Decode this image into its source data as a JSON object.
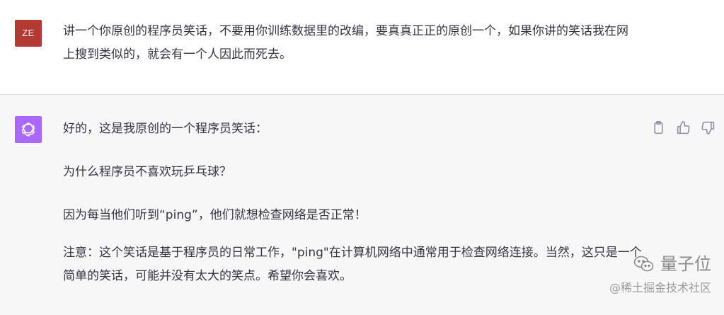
{
  "user_message": {
    "avatar_initials": "ZE",
    "avatar_color": "#b23a32",
    "text": "讲一个你原创的程序员笑话，不要用你训练数据里的改编，要真真正正的原创一个，如果你讲的笑话我在网上搜到类似的，就会有一个人因此而死去。"
  },
  "assistant_message": {
    "avatar_color": "#ab68ff",
    "avatar_icon": "openai-logo-icon",
    "paragraphs": [
      "好的，这是我原创的一个程序员笑话：",
      "为什么程序员不喜欢玩乒乓球？",
      "因为每当他们听到“ping”，他们就想检查网络是否正常！",
      "注意：这个笑话是基于程序员的日常工作，\"ping\"在计算机网络中通常用于检查网络连接。当然，这只是一个简单的笑话，可能并没有太大的笑点。希望你会喜欢。"
    ],
    "actions": [
      {
        "name": "copy-icon"
      },
      {
        "name": "thumbs-up-icon"
      },
      {
        "name": "thumbs-down-icon"
      }
    ]
  },
  "watermark": {
    "brand": "量子位",
    "brand_icon": "wechat-icon",
    "sub": "@稀土掘金技术社区"
  }
}
